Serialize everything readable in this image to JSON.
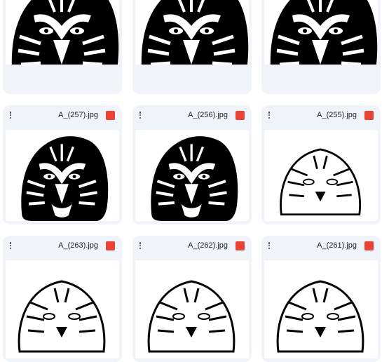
{
  "files": [
    {
      "name": "",
      "icon": "image-file-icon",
      "thumb": "tiger-face-left"
    },
    {
      "name": "",
      "icon": "image-file-icon",
      "thumb": "tiger-face-symmetric"
    },
    {
      "name": "",
      "icon": "image-file-icon",
      "thumb": "tiger-face-symmetric"
    },
    {
      "name": "A_(257).jpg",
      "icon": "image-file-icon",
      "thumb": "tiger-head-bold"
    },
    {
      "name": "A_(256).jpg",
      "icon": "image-file-icon",
      "thumb": "tiger-head-bold"
    },
    {
      "name": "A_(255).jpg",
      "icon": "image-file-icon",
      "thumb": "tiger-peeking-paws"
    },
    {
      "name": "A_(263).jpg",
      "icon": "image-file-icon",
      "thumb": "tiger-walking"
    },
    {
      "name": "A_(262).jpg",
      "icon": "image-file-icon",
      "thumb": "tiger-cub-cartoon"
    },
    {
      "name": "A_(261).jpg",
      "icon": "image-file-icon",
      "thumb": "tiger-lying"
    }
  ],
  "colors": {
    "card_bg": "#f0f4f9",
    "file_icon": "#ea4335",
    "text": "#1f1f1f"
  }
}
